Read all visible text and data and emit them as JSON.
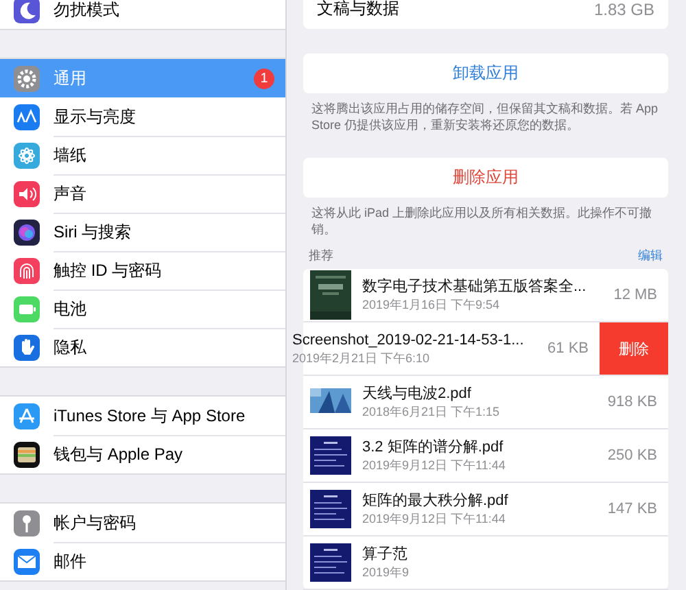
{
  "sidebar": {
    "groups": [
      {
        "items": [
          {
            "label": "勿扰模式",
            "kind": "moon",
            "color": "#5856d6",
            "selected": false
          }
        ]
      },
      {
        "items": [
          {
            "label": "通用",
            "kind": "gear",
            "color": "#8e8e93",
            "selected": true,
            "badge": "1"
          },
          {
            "label": "显示与亮度",
            "kind": "text-size",
            "color": "#1a7cf0",
            "selected": false
          },
          {
            "label": "墙纸",
            "kind": "flower",
            "color": "#36aadc",
            "selected": false
          },
          {
            "label": "声音",
            "kind": "speaker",
            "color": "#f23a5a",
            "selected": false
          },
          {
            "label": "Siri 与搜索",
            "kind": "siri",
            "color": "#222244",
            "selected": false
          },
          {
            "label": "触控 ID 与密码",
            "kind": "fingerprint",
            "color": "#f2405e",
            "selected": false
          },
          {
            "label": "电池",
            "kind": "battery",
            "color": "#4cd964",
            "selected": false
          },
          {
            "label": "隐私",
            "kind": "hand",
            "color": "#1a6fe0",
            "selected": false
          }
        ]
      },
      {
        "items": [
          {
            "label": "iTunes Store 与 App Store",
            "kind": "app-store",
            "color": "#2a9af5",
            "selected": false
          },
          {
            "label": "钱包与 Apple Pay",
            "kind": "wallet",
            "color": "#111111",
            "selected": false
          }
        ]
      },
      {
        "items": [
          {
            "label": "帐户与密码",
            "kind": "key",
            "color": "#8e8e93",
            "selected": false
          },
          {
            "label": "邮件",
            "kind": "mail",
            "color": "#1e7ff2",
            "selected": false
          }
        ]
      }
    ]
  },
  "storage": {
    "label": "文稿与数据",
    "value": "1.83 GB"
  },
  "offload": {
    "button": "卸载应用",
    "note": "这将腾出该应用占用的储存空间，但保留其文稿和数据。若 App Store 仍提供该应用，重新安装将还原您的数据。"
  },
  "delete_app": {
    "button": "删除应用",
    "note": "这将从此 iPad 上删除此应用以及所有相关数据。此操作不可撤销。"
  },
  "files": {
    "header": "推荐",
    "edit": "编辑",
    "delete_label": "删除",
    "items": [
      {
        "title": "数字电子技术基础第五版答案全...",
        "date": "2019年1月16日 下午9:54",
        "size": "12 MB",
        "kind": "book",
        "swiped": false
      },
      {
        "title": "Screenshot_2019-02-21-14-53-1...",
        "date": "2019年2月21日 下午6:10",
        "size": "61 KB",
        "swiped": true
      },
      {
        "title": "天线与电波2.pdf",
        "date": "2018年6月21日 下午1:15",
        "size": "918 KB",
        "swiped": false
      },
      {
        "title": "3.2 矩阵的谱分解.pdf",
        "date": "2019年9月12日 下午11:44",
        "size": "250 KB",
        "kind": "slide",
        "swiped": false
      },
      {
        "title": "矩阵的最大秩分解.pdf",
        "date": "2019年9月12日 下午11:44",
        "size": "147 KB",
        "kind": "slide",
        "swiped": false
      },
      {
        "title": "算子范",
        "date": "2019年9",
        "kind": "slide",
        "swiped": false
      }
    ]
  }
}
